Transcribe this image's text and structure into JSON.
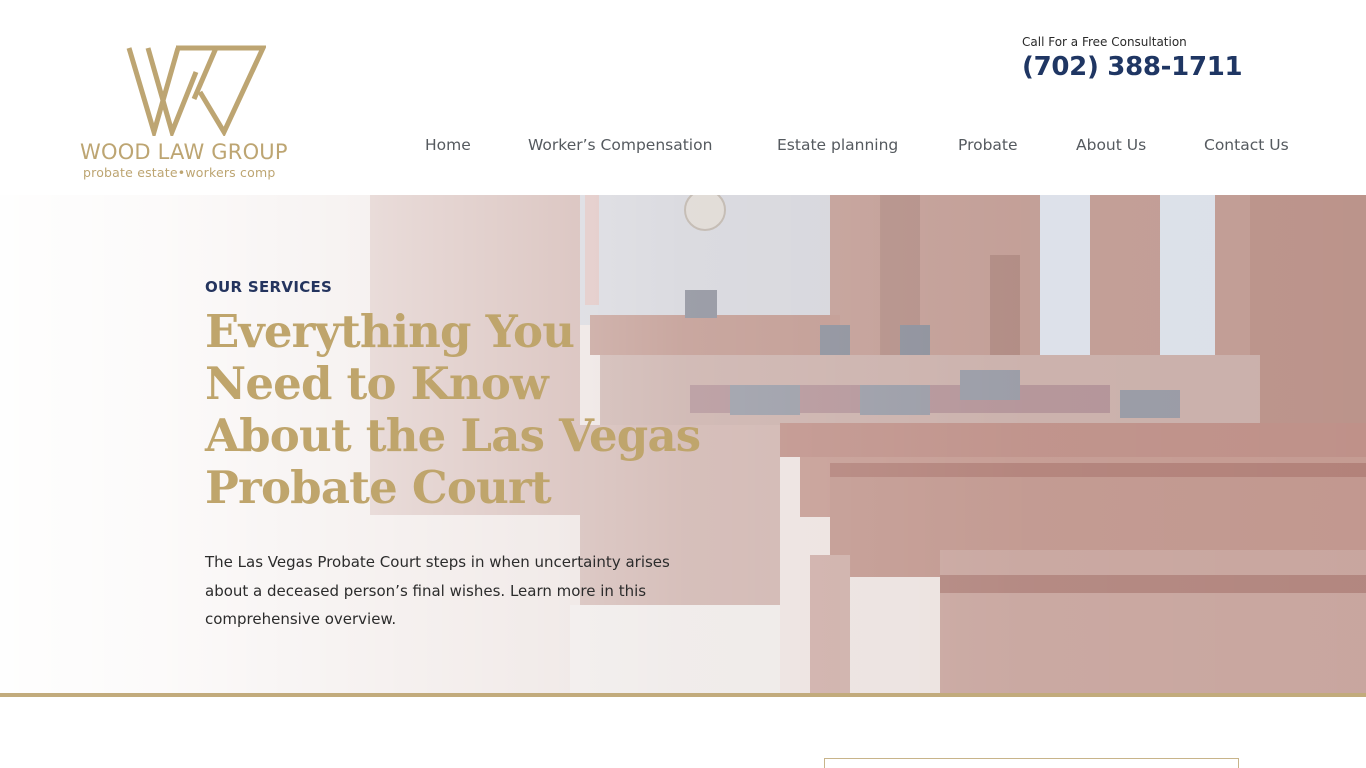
{
  "brand": {
    "name": "WOOD LAW GROUP",
    "tagline": "probate  estate•workers comp",
    "color": "#bda572"
  },
  "header": {
    "consult_label": "Call For a Free Consultation",
    "phone": "(702) 388-1711",
    "phone_color": "#1f3663"
  },
  "nav": {
    "items": [
      {
        "label": "Home"
      },
      {
        "label": "Worker’s Compensation"
      },
      {
        "label": "Estate planning"
      },
      {
        "label": "Probate"
      },
      {
        "label": "About Us"
      },
      {
        "label": "Contact Us"
      }
    ]
  },
  "hero": {
    "eyebrow": "OUR SERVICES",
    "title": "Everything You Need to Know About the Las Vegas Probate Court",
    "description": "The Las Vegas Probate Court steps in when uncertainty arises about a deceased person’s final wishes. Learn more in this comprehensive overview.",
    "background": "courtroom-photo",
    "title_color": "#bfa56c",
    "accent_rule_color": "#c2ab7c"
  }
}
